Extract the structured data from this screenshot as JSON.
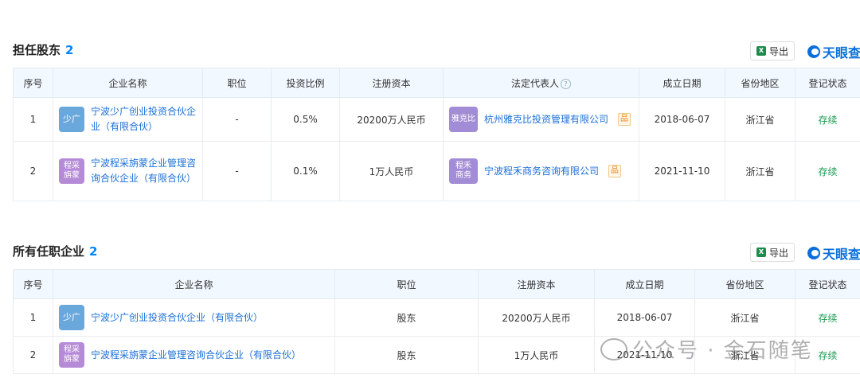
{
  "section1": {
    "title": "担任股东",
    "count": "2",
    "export_label": "导出",
    "brand": "天眼查",
    "headers": [
      "序号",
      "企业名称",
      "职位",
      "投资比例",
      "注册资本",
      "法定代表人",
      "成立日期",
      "省份地区",
      "登记状态"
    ],
    "rows": [
      {
        "index": "1",
        "logo": "少广",
        "name": "宁波少广创业投资合伙企业（有限合伙）",
        "position": "-",
        "ratio": "0.5%",
        "capital": "20200万人民币",
        "rep_logo": "雅克比",
        "rep": "杭州雅克比投资管理有限公司",
        "date": "2018-06-07",
        "region": "浙江省",
        "status": "存续"
      },
      {
        "index": "2",
        "logo": "程采旃蒙",
        "name": "宁波程采旃蒙企业管理咨询合伙企业（有限合伙）",
        "position": "-",
        "ratio": "0.1%",
        "capital": "1万人民币",
        "rep_logo": "程禾商务",
        "rep": "宁波程禾商务咨询有限公司",
        "date": "2021-11-10",
        "region": "浙江省",
        "status": "存续"
      }
    ]
  },
  "section2": {
    "title": "所有任职企业",
    "count": "2",
    "export_label": "导出",
    "brand": "天眼查",
    "headers": [
      "序号",
      "企业名称",
      "职位",
      "注册资本",
      "成立日期",
      "省份地区",
      "登记状态"
    ],
    "rows": [
      {
        "index": "1",
        "logo": "少广",
        "name": "宁波少广创业投资合伙企业（有限合伙）",
        "position": "股东",
        "capital": "20200万人民币",
        "date": "2018-06-07",
        "region": "浙江省",
        "status": "存续"
      },
      {
        "index": "2",
        "logo": "程采旃蒙",
        "name": "宁波程采旃蒙企业管理咨询合伙企业（有限合伙）",
        "position": "股东",
        "capital": "1万人民币",
        "date": "2021-11-10",
        "region": "浙江省",
        "status": "存续"
      }
    ]
  },
  "watermark": "公众号 · 金石随笔",
  "colors": {
    "link": "#1a6fd8",
    "status": "#1a9a52",
    "count": "#0084ff",
    "header_bg": "#f2f8ff"
  }
}
